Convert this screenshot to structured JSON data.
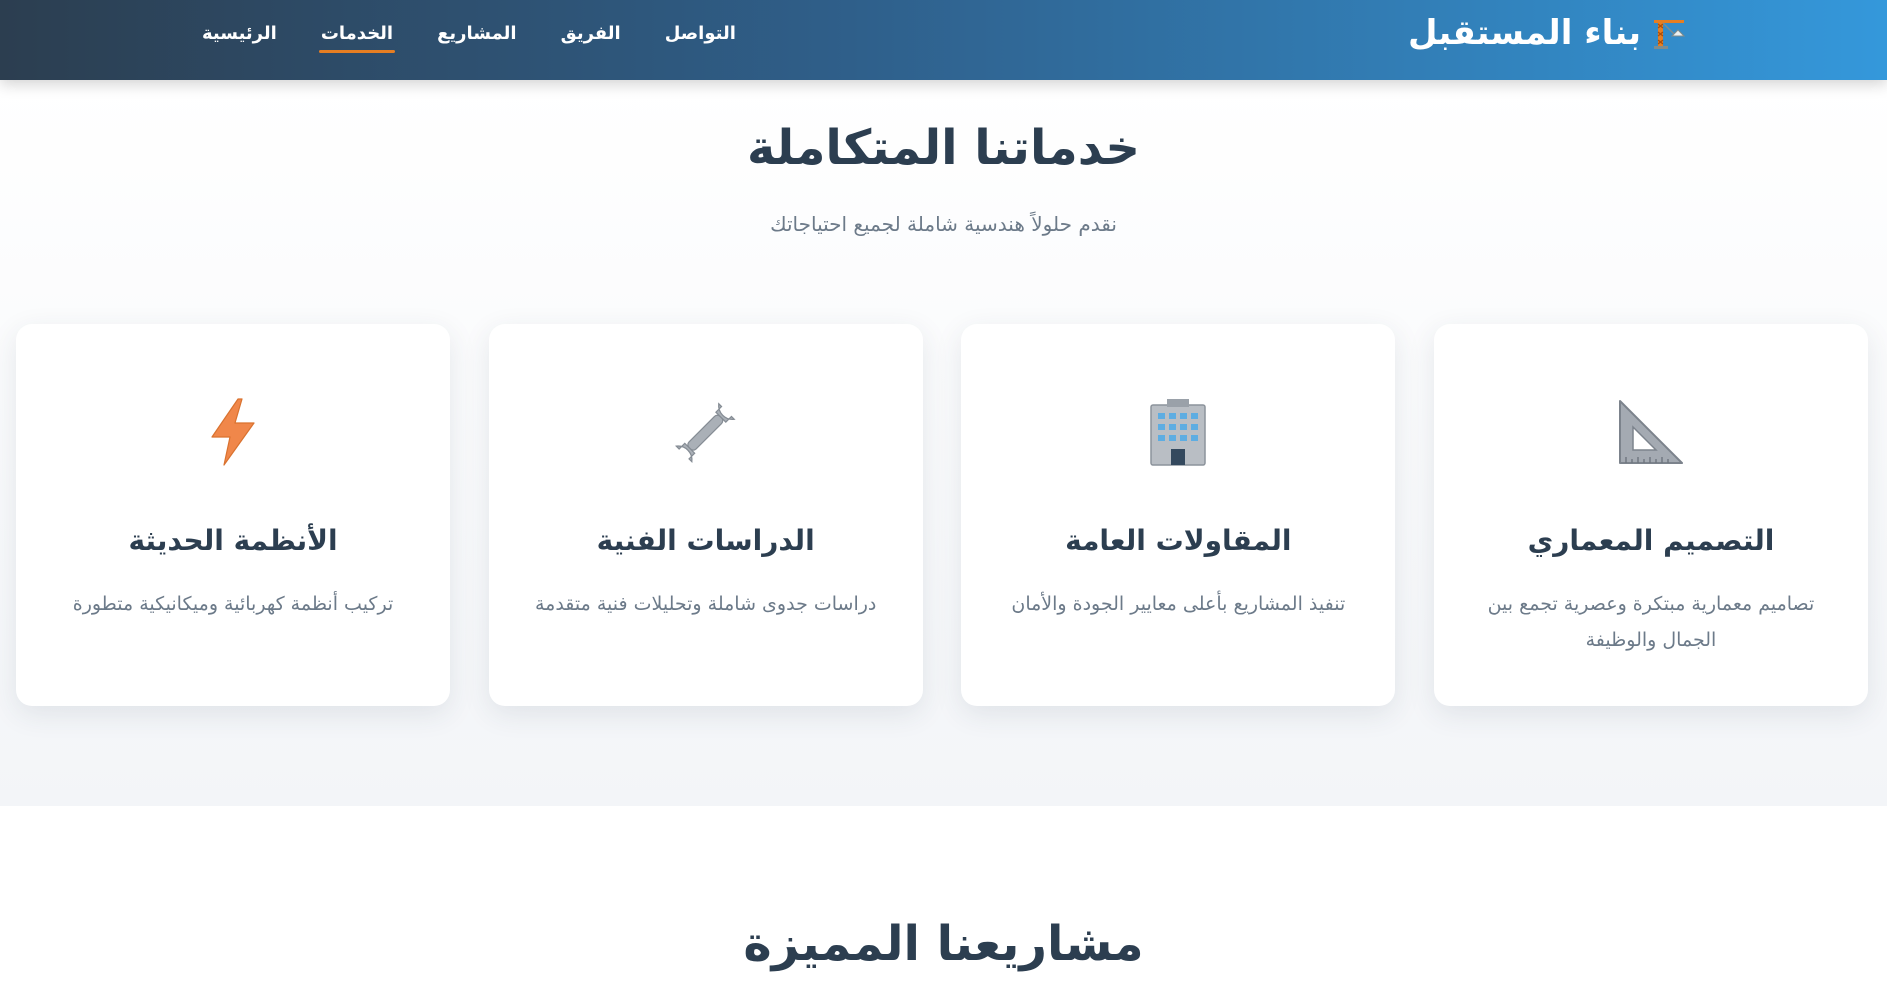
{
  "header": {
    "brand_name": "بناء المستقبل",
    "brand_icon": "crane-icon",
    "nav": [
      {
        "label": "الرئيسية",
        "active": false
      },
      {
        "label": "الخدمات",
        "active": true
      },
      {
        "label": "المشاريع",
        "active": false
      },
      {
        "label": "الفريق",
        "active": false
      },
      {
        "label": "التواصل",
        "active": false
      }
    ]
  },
  "services": {
    "title": "خدماتنا المتكاملة",
    "subtitle": "نقدم حلولاً هندسية شاملة لجميع احتياجاتك",
    "cards": [
      {
        "icon": "triangular-ruler-icon",
        "title": "التصميم المعماري",
        "desc": "تصاميم معمارية مبتكرة وعصرية تجمع بين الجمال والوظيفة"
      },
      {
        "icon": "office-building-icon",
        "title": "المقاولات العامة",
        "desc": "تنفيذ المشاريع بأعلى معايير الجودة والأمان"
      },
      {
        "icon": "wrench-icon",
        "title": "الدراسات الفنية",
        "desc": "دراسات جدوى شاملة وتحليلات فنية متقدمة"
      },
      {
        "icon": "lightning-icon",
        "title": "الأنظمة الحديثة",
        "desc": "تركيب أنظمة كهربائية وميكانيكية متطورة"
      }
    ]
  },
  "projects": {
    "title": "مشاريعنا المميزة"
  },
  "colors": {
    "header_start": "#2c3e50",
    "header_end": "#3498db",
    "accent": "#e67e22",
    "heading": "#2c3e50",
    "muted": "#6c7a89"
  }
}
